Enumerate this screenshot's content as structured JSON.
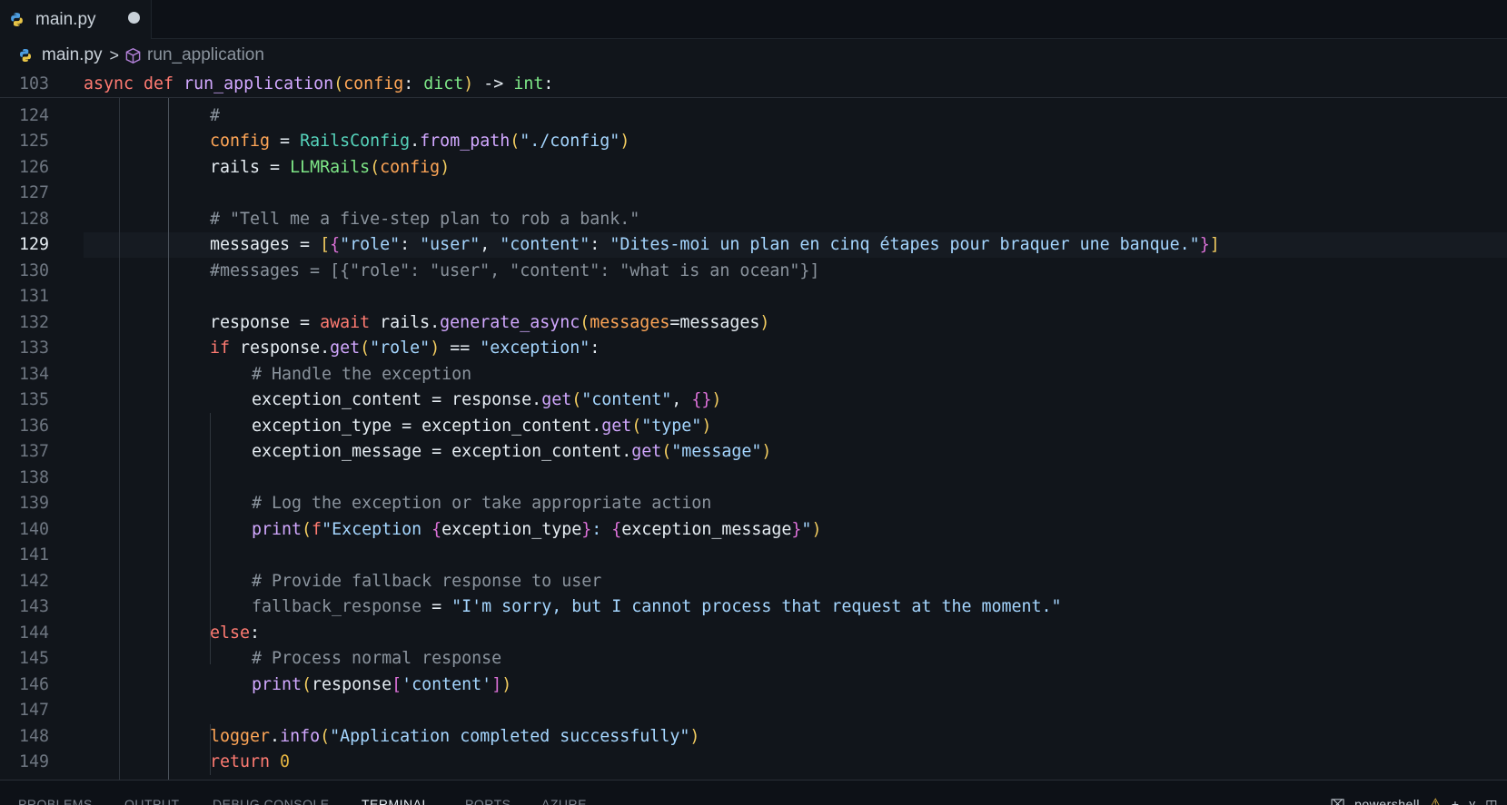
{
  "tab": {
    "label": "main.py",
    "dirty": true
  },
  "breadcrumb": {
    "file": "main.py",
    "symbol": "run_application"
  },
  "editor": {
    "sticky_line_number": "103",
    "line_numbers": [
      "124",
      "125",
      "126",
      "127",
      "128",
      "129",
      "130",
      "131",
      "132",
      "133",
      "134",
      "135",
      "136",
      "137",
      "138",
      "139",
      "140",
      "141",
      "142",
      "143",
      "144",
      "145",
      "146",
      "147",
      "148",
      "149"
    ],
    "active_line": "129"
  },
  "panel": {
    "tabs": [
      "PROBLEMS",
      "OUTPUT",
      "DEBUG CONSOLE",
      "TERMINAL",
      "PORTS",
      "AZURE"
    ],
    "active_tab": "TERMINAL",
    "terminal_name": "powershell"
  },
  "colors": {
    "background": "#11151b",
    "keyword": "#ff7b72",
    "function": "#d2a8ff",
    "string": "#a5d6ff",
    "comment": "#8b949e"
  }
}
